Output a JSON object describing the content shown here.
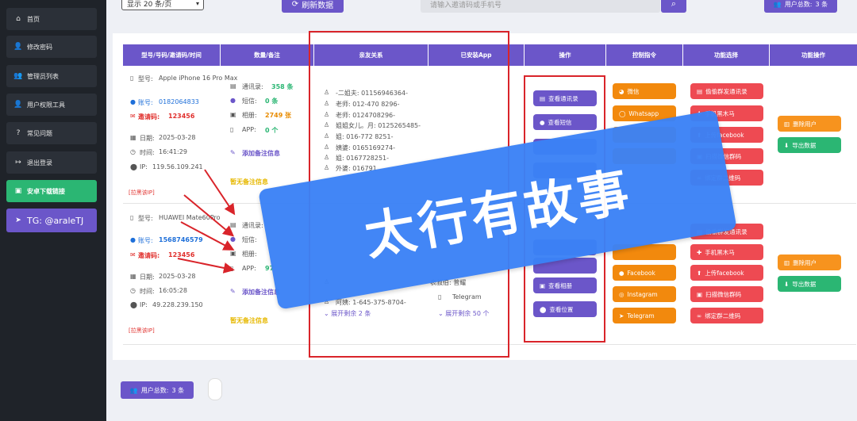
{
  "sidebar": {
    "items": [
      {
        "label": "首页",
        "icon": "home-icon"
      },
      {
        "label": "修改密码",
        "icon": "user-edit-icon"
      },
      {
        "label": "管理员列表",
        "icon": "users-icon"
      },
      {
        "label": "用户权限工具",
        "icon": "user-gear-icon"
      },
      {
        "label": "常见问题",
        "icon": "question-icon"
      },
      {
        "label": "退出登录",
        "icon": "logout-icon"
      },
      {
        "label": "安卓下载链接",
        "icon": "android-icon"
      },
      {
        "label": "TG: @araleTJ",
        "icon": "telegram-icon"
      }
    ]
  },
  "toolbar": {
    "page_size": "显示 20 条/页",
    "refresh_label": "刷新数据",
    "search_placeholder": "请输入邀请码或手机号",
    "user_total_label": "用户总数:",
    "user_total_value": "3 条"
  },
  "table": {
    "headers": [
      "型号/号码/邀请码/时间",
      "数量/备注",
      "亲友关系",
      "已安装App",
      "操作",
      "控制指令",
      "功能选择",
      "功能操作"
    ],
    "rows": [
      {
        "model_label": "型号:",
        "model": "Apple iPhone 16 Pro Max",
        "account_label": "账号:",
        "account": "0182064833",
        "invite_label": "邀请码:",
        "invite": "123456",
        "date_label": "日期:",
        "date": "2025-03-28",
        "time_label": "时间:",
        "time": "16:41:29",
        "ip_label": "IP:",
        "ip": "119.56.109.241",
        "blacklist": "[拉黑该IP]",
        "contacts_label": "通讯录:",
        "contacts": "358 条",
        "sms_label": "短信:",
        "sms": "0 条",
        "album_label": "相册:",
        "album": "2749 张",
        "app_label": "APP:",
        "app": "0 个",
        "add_note": "添加备注信息",
        "no_note": "暂无备注信息",
        "relations": [
          "-二姐夫: 01156946364-",
          "老师: 012-470 8296-",
          "老师: 0124708296-",
          "姐姐女儿。月: 0125265485-",
          "姐: 016-772 8251-",
          "姨婆: 0165169274-",
          "姐: 0167728251-",
          "外婆: 016791"
        ],
        "ops": [
          "查看通讯录",
          "查看短信"
        ],
        "commands": [
          "微信",
          "Whatsapp"
        ],
        "functions": [
          "偷偷群发通讯录",
          "手机黑木马",
          "上传facebook",
          "扫描微信群码",
          "绑定群二维码"
        ],
        "actions": [
          "删除用户",
          "导出数据"
        ]
      },
      {
        "model_label": "型号:",
        "model": "HUAWEI Mate60Pro",
        "account_label": "账号:",
        "account": "1568746579",
        "invite_label": "邀请码:",
        "invite": "123456",
        "date_label": "日期:",
        "date": "2025-03-28",
        "time_label": "时间:",
        "time": "16:05:28",
        "ip_label": "IP:",
        "ip": "49.228.239.150",
        "blacklist": "[拉黑该IP]",
        "contacts_label": "通讯录:",
        "sms_label": "短信:",
        "album_label": "相册:",
        "app_label": "APP:",
        "app": "97",
        "add_note": "添加备注信息",
        "no_note": "暂无备注信息",
        "relations_tail": [
          "表叔伯: 普耀",
          "阿姨: 1-645-375-8704-"
        ],
        "relations_more": "展开剩余 2 条",
        "app_item": "Telegram",
        "apps_more": "展开剩余 50 个",
        "ops": [
          "查看相册",
          "查看位置"
        ],
        "commands": [
          "Facebook",
          "Instagram",
          "Telegram"
        ],
        "functions": [
          "手机黑木马",
          "上传facebook",
          "扫描微信群码",
          "绑定群二维码"
        ],
        "functions_top": "偷偷群发通讯录",
        "actions": [
          "删除用户",
          "导出数据"
        ]
      }
    ]
  },
  "watermark": "太行有故事",
  "footer": {
    "user_total_label": "用户总数:",
    "user_total_value": "3 条"
  },
  "colors": {
    "primary": "#6b56c9",
    "sidebar": "#1f2329",
    "green": "#2bb673",
    "orange": "#f2890d",
    "red": "#ee4a52",
    "annotation": "#d9242a",
    "watermark": "#3b82f6"
  }
}
